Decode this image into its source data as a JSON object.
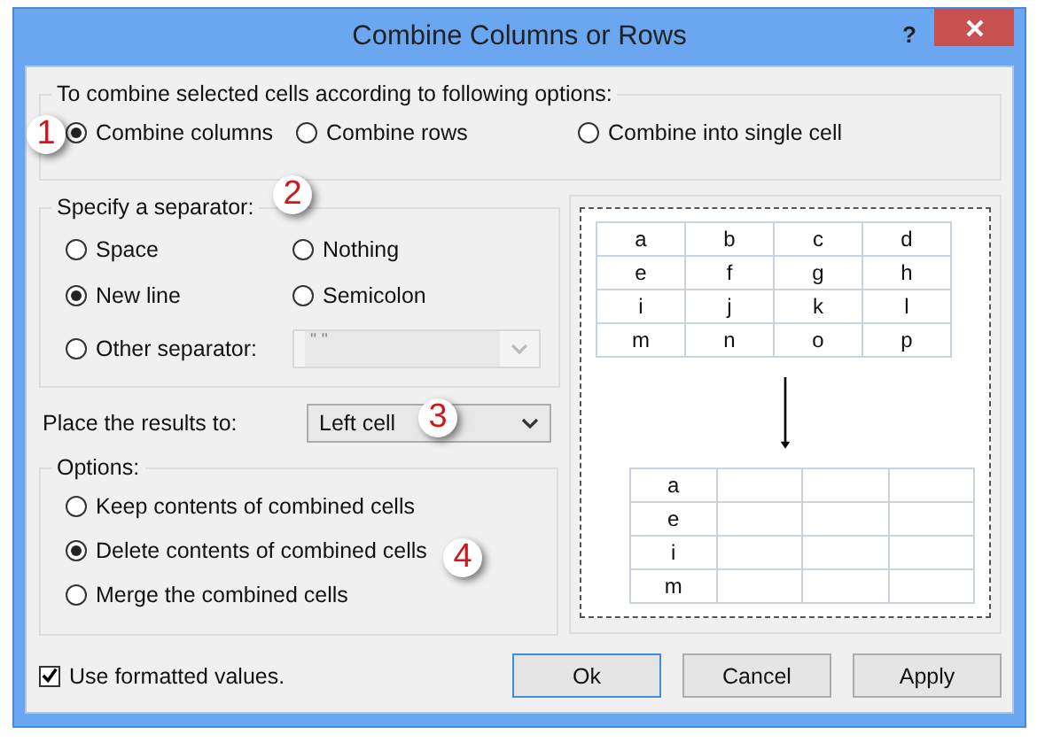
{
  "window": {
    "title": "Combine Columns or Rows",
    "help": "?"
  },
  "combine": {
    "legend": "To combine selected cells according to following options:",
    "options": [
      {
        "label": "Combine columns",
        "selected": true
      },
      {
        "label": "Combine rows",
        "selected": false
      },
      {
        "label": "Combine into single cell",
        "selected": false
      }
    ]
  },
  "separator": {
    "legend": "Specify a separator:",
    "options": [
      {
        "label": "Space",
        "selected": false
      },
      {
        "label": "Nothing",
        "selected": false
      },
      {
        "label": "New line",
        "selected": true
      },
      {
        "label": "Semicolon",
        "selected": false
      },
      {
        "label": "Other separator:",
        "selected": false
      }
    ],
    "other_value": "\" \"",
    "other_disabled": true
  },
  "place": {
    "label": "Place the results to:",
    "value": "Left cell"
  },
  "options": {
    "legend": "Options:",
    "items": [
      {
        "label": "Keep contents of combined cells",
        "selected": false
      },
      {
        "label": "Delete contents of combined cells",
        "selected": true
      },
      {
        "label": "Merge the combined cells",
        "selected": false
      }
    ]
  },
  "preview": {
    "source": [
      [
        "a",
        "b",
        "c",
        "d"
      ],
      [
        "e",
        "f",
        "g",
        "h"
      ],
      [
        "i",
        "j",
        "k",
        "l"
      ],
      [
        "m",
        "n",
        "o",
        "p"
      ]
    ],
    "result_first_column": [
      "a",
      "e",
      "i",
      "m"
    ]
  },
  "use_formatted": {
    "label": "Use formatted values.",
    "checked": true
  },
  "buttons": [
    {
      "label": "Ok",
      "default": true
    },
    {
      "label": "Cancel",
      "default": false
    },
    {
      "label": "Apply",
      "default": false
    }
  ],
  "callouts": [
    "1",
    "2",
    "3",
    "4"
  ]
}
